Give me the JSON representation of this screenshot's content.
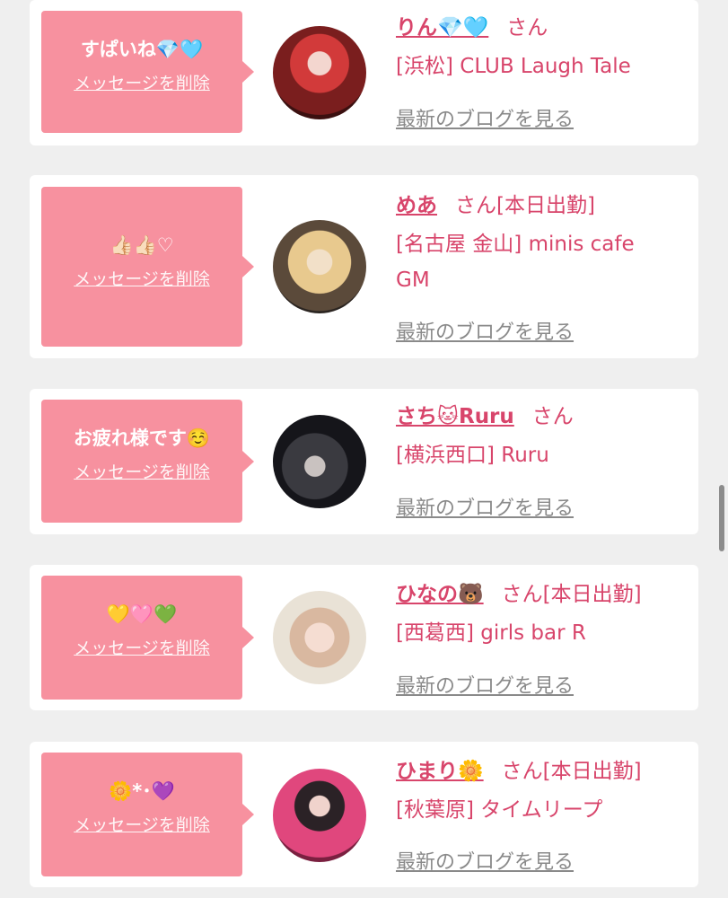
{
  "entries": [
    {
      "message": "すぱいね💎🩵",
      "delete_label": "メッセージを削除",
      "name": "りん💎🩵",
      "honorific": "さん",
      "status": "",
      "shop": "[浜松] CLUB Laugh Tale",
      "blog_label": "最新のブログを見る"
    },
    {
      "message": "👍🏻👍🏻♡",
      "delete_label": "メッセージを削除",
      "name": "めあ",
      "honorific": "さん",
      "status": "[本日出勤]",
      "shop": "[名古屋 金山] minis cafe GM",
      "blog_label": "最新のブログを見る"
    },
    {
      "message": "お疲れ様です☺️",
      "delete_label": "メッセージを削除",
      "name": "さち🐱Ruru",
      "honorific": "さん",
      "status": "",
      "shop": "[横浜西口] Ruru",
      "blog_label": "最新のブログを見る"
    },
    {
      "message": "💛🩷💚",
      "delete_label": "メッセージを削除",
      "name": "ひなの🐻",
      "honorific": "さん",
      "status": "[本日出勤]",
      "shop": "[西葛西] girls bar R",
      "blog_label": "最新のブログを見る"
    },
    {
      "message": "🌼*･💜",
      "delete_label": "メッセージを削除",
      "name": "ひまり🌼",
      "honorific": "さん",
      "status": "[本日出勤]",
      "shop": "[秋葉原] タイムリープ",
      "blog_label": "最新のブログを見る"
    }
  ],
  "colors": {
    "accent": "#d8456b",
    "bubble": "#f7919f",
    "muted": "#8a8a8a",
    "background": "#efefef"
  }
}
